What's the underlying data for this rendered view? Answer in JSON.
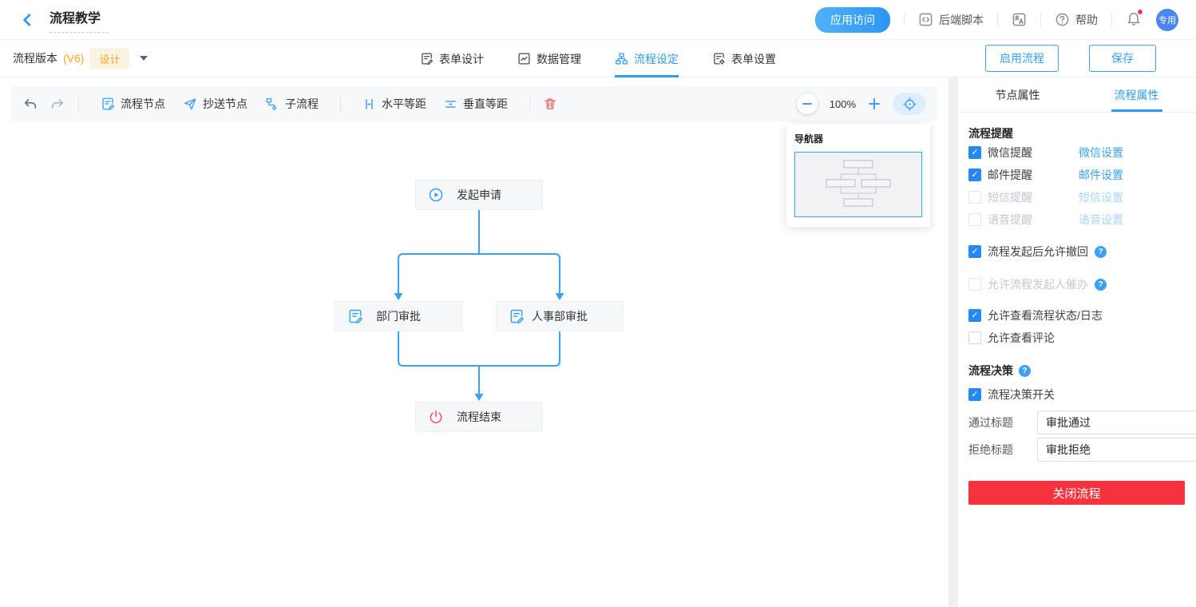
{
  "header": {
    "title": "流程教学",
    "app_access": "应用访问",
    "backend_script": "后端脚本",
    "help": "帮助",
    "avatar": "专用"
  },
  "subheader": {
    "version_label": "流程版本",
    "version_tag": "(V6)",
    "design_badge": "设计",
    "tabs": [
      {
        "label": "表单设计"
      },
      {
        "label": "数据管理"
      },
      {
        "label": "流程设定"
      },
      {
        "label": "表单设置"
      }
    ],
    "active_tab": "流程设定",
    "enable_button": "启用流程",
    "save_button": "保存"
  },
  "toolbar": {
    "node_button": "流程节点",
    "cc_button": "抄送节点",
    "subflow_button": "子流程",
    "h_space_button": "水平等距",
    "v_space_button": "垂直等距",
    "zoom_level": "100%"
  },
  "navigator": {
    "title": "导航器"
  },
  "flow": {
    "start": "发起申请",
    "dept": "部门审批",
    "hr": "人事部审批",
    "end": "流程结束"
  },
  "sidebar": {
    "tab_node": "节点属性",
    "tab_flow": "流程属性",
    "remind_title": "流程提醒",
    "remind_rows": [
      {
        "label": "微信提醒",
        "link": "微信设置",
        "checked": true,
        "disabled": false
      },
      {
        "label": "邮件提醒",
        "link": "邮件设置",
        "checked": true,
        "disabled": false
      },
      {
        "label": "短信提醒",
        "link": "短信设置",
        "checked": false,
        "disabled": true
      },
      {
        "label": "语音提醒",
        "link": "语音设置",
        "checked": false,
        "disabled": true
      }
    ],
    "options": [
      {
        "label": "流程发起后允许撤回",
        "checked": true,
        "help": true,
        "disabled": false
      },
      {
        "label": "允许流程发起人催办",
        "checked": false,
        "help": true,
        "disabled": true
      },
      {
        "label": "允许查看流程状态/日志",
        "checked": true,
        "help": false,
        "disabled": false
      },
      {
        "label": "允许查看评论",
        "checked": false,
        "help": false,
        "disabled": false
      }
    ],
    "decision_title": "流程决策",
    "decision_switch": "流程决策开关",
    "pass_label": "通过标题",
    "pass_value": "审批通过",
    "reject_label": "拒绝标题",
    "reject_value": "审批拒绝",
    "close_button": "关闭流程"
  },
  "colors": {
    "accent": "#2f9bf4",
    "link": "#3da0f8",
    "link_disabled": "#a9d5fb",
    "orange": "#f7a62a",
    "red": "#f7323f",
    "checkbox": "#2589f5"
  }
}
